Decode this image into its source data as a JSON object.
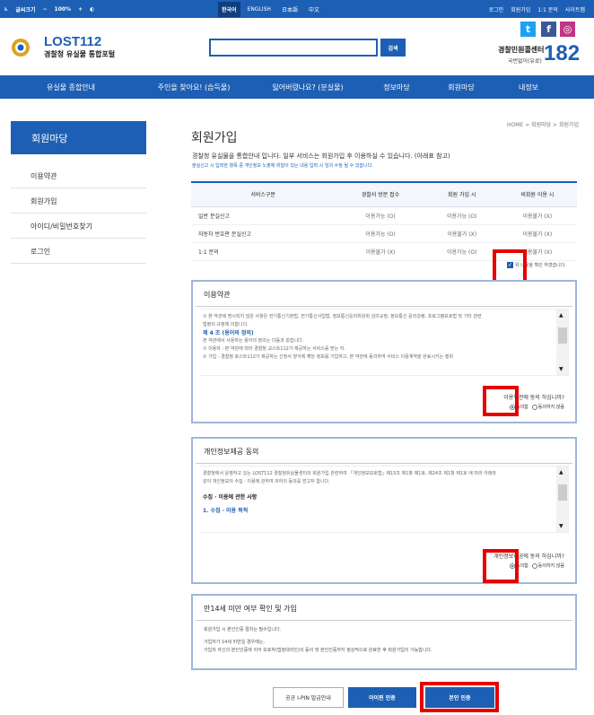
{
  "topbar": {
    "accessibility_label": "글씨크기",
    "zoom_minus": "−",
    "zoom_value": "100%",
    "zoom_plus": "+",
    "languages": [
      "한국어",
      "ENGLISH",
      "日本語",
      "中文"
    ],
    "links": [
      "로그인",
      "회원가입",
      "1:1 문의",
      "사이트맵"
    ]
  },
  "header": {
    "logo_en": "LOST112",
    "logo_ko": "경찰청 유실물 통합포털",
    "search_button": "검색",
    "callcenter_name": "경찰민원콜센터",
    "callcenter_sub": "국번없이(유료)",
    "callcenter_number": "182"
  },
  "nav": [
    "유실물 종합안내",
    "주인을 찾아요! (습득물)",
    "잃어버렸나요? (분실물)",
    "정보마당",
    "회원마당",
    "내정보"
  ],
  "sidebar": {
    "title": "회원마당",
    "items": [
      "이용약관",
      "회원가입",
      "아이디/비밀번호찾기",
      "로그인"
    ]
  },
  "main": {
    "breadcrumb": "HOME > 회원마당 > 회원가입",
    "title": "회원가입",
    "intro": "경찰청 유실물을 통합안내 입니다. 일부 서비스는 회원가입 후 이용하실 수 있습니다. (아래표 참고)",
    "intro_note": "분실신고 시 입력한 항목 중 개인정보 노출에 위험이 있는 내용 입력 시 임의 수정 될 수 있습니다.",
    "table": {
      "headers": [
        "서비스구분",
        "경찰서 방문 접수",
        "회원 가입 시",
        "비회원 이용 시"
      ],
      "rows": [
        [
          "일반 분실신고",
          "이용가능 (O)",
          "이용가능 (O)",
          "이용불가 (X)"
        ],
        [
          "자동차 번호판 분실신고",
          "이용가능 (O)",
          "이용불가 (X)",
          "이용불가 (X)"
        ],
        [
          "1:1 문의",
          "이용불가 (X)",
          "이용가능 (O)",
          "이용불가 (X)"
        ]
      ]
    },
    "confirm_check": "위 내용을 확인 하였습니다.",
    "terms": {
      "title": "이용약관",
      "line1": "① 본 약관에 명시되지 않은 사항은 전기통신기본법, 전기통신사업법, 정보통신윤리위원회 심의규정, 정보통신 윤리강령, 프로그램보호법 및 기타 관련",
      "line2": "법령의 규정에 의합니다.",
      "heading": "제 4 조 (용어의 정의)",
      "line3": "본 약관에서 사용하는 용어의 정의는 다음과 같습니다.",
      "line4": "① 이용자 : 본 약관에 따라 경찰청 교스트112가 제공하는 서비스를 받는 자.",
      "line5": "② 가입 : 경찰청 로스트112가 제공하는 신청서 양식에 해당 정보를 기입하고, 본 약관에 동의하여 서비스 이용계약을 완료시키는 행위",
      "question": "이용약관에 동의 하십니까?",
      "agree": "동의함",
      "disagree": "동의하지 않음"
    },
    "privacy": {
      "title": "개인정보제공 동의",
      "line1": "경찰청에서 운영하고 있는 LOST112 경찰청유실물센터의 회원가입 관련하여 「개인정보보호법」제15조 제1항 제1호, 제24조 제1항 제1호 에 따라 아래와",
      "line2": "같이 개인정보의 수집 · 이용에 관하여 귀하의 동의를 얻고자 합니다.",
      "heading1": "수집 · 이용에 관한 사항",
      "heading2": "1. 수집 · 이용 목적",
      "question": "개인정보제공에 동의 하십니까?",
      "agree": "동의함",
      "disagree": "동의하지 않음"
    },
    "age": {
      "title": "만14세 미만 여부 확인 및 가입",
      "line1": "회원가입 시 본인인증 절차는 필수입니다.",
      "line2": "가입자가 14세 미만일 경우에는,",
      "line3": "가입자 자신의 본인인증에 이어 보호자(법정대리인)의 동의 및 본인인증까지 정상적으로 완료한 후 회원가입이 가능합니다."
    },
    "buttons": {
      "ipin_guide": "공공 I-PIN 발급안내",
      "ipin": "아이핀 인증",
      "self": "본인 인증"
    }
  }
}
